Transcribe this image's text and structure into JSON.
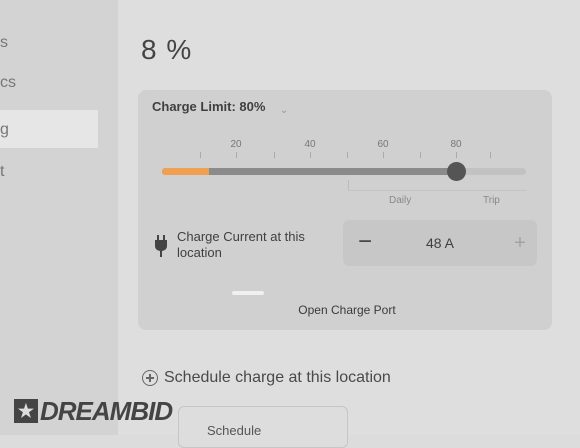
{
  "sidebar": {
    "items": [
      {
        "label": "s"
      },
      {
        "label": "cs"
      },
      {
        "label": "g"
      },
      {
        "label": "t"
      }
    ]
  },
  "battery": {
    "percent_label": "8 %"
  },
  "charge_limit": {
    "label": "Charge Limit: 80%",
    "value_percent": 80,
    "current_charge_percent": 8,
    "tick_labels": [
      "20",
      "40",
      "60",
      "80"
    ],
    "range_labels": {
      "daily": "Daily",
      "trip": "Trip"
    }
  },
  "charge_current": {
    "label": "Charge Current at this location",
    "minus_symbol": "−",
    "value": "48 A",
    "plus_symbol": "+"
  },
  "open_port_label": "Open Charge Port",
  "schedule": {
    "label": "Schedule charge at this location"
  },
  "bottom_partial_label": "Schedule",
  "watermark": {
    "badge": "★",
    "text": "DREAMBID"
  },
  "colors": {
    "accent_orange": "#f0a050",
    "thumb": "#555555"
  }
}
